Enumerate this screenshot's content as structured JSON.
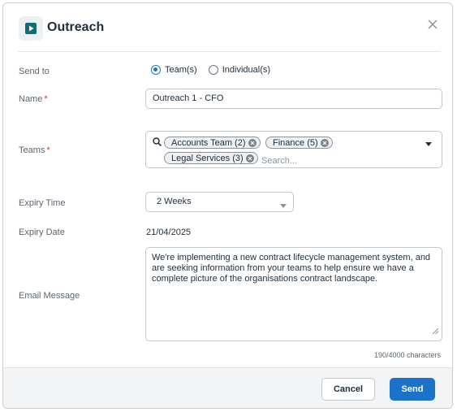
{
  "dialog": {
    "title": "Outreach",
    "icon": "play-tile-icon",
    "accent_color": "#0e6e78"
  },
  "form": {
    "send_to": {
      "label": "Send to",
      "options": [
        "Team(s)",
        "Individual(s)"
      ],
      "selected": "Team(s)"
    },
    "name": {
      "label": "Name",
      "required_mark": "*",
      "value": "Outreach 1 - CFO"
    },
    "teams": {
      "label": "Teams",
      "required_mark": "*",
      "selected": [
        "Accounts Team (2)",
        "Finance (5)",
        "Legal Services (3)"
      ],
      "search_placeholder": "Search..."
    },
    "expiry_time": {
      "label": "Expiry Time",
      "value": "2 Weeks"
    },
    "expiry_date": {
      "label": "Expiry Date",
      "value": "21/04/2025"
    },
    "email_message": {
      "label": "Email Message",
      "value": "We're implementing a new contract lifecycle management system, and are seeking information from your teams to help ensure we have a complete picture of the organisations contract landscape.",
      "char_count": "190/4000 characters"
    }
  },
  "footer": {
    "cancel_label": "Cancel",
    "send_label": "Send",
    "primary_color": "#1a73c9"
  }
}
